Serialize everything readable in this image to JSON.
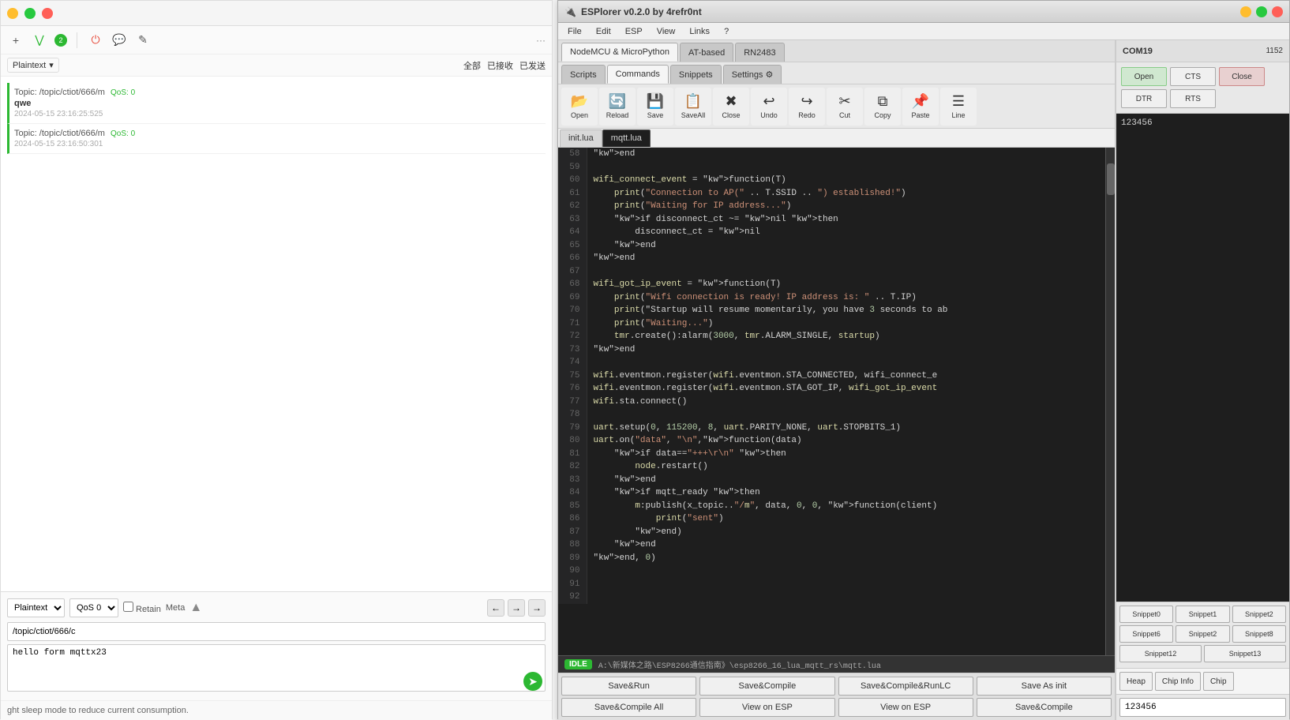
{
  "left_panel": {
    "toolbar": {
      "add_icon": "+",
      "expand_icon": "⋁",
      "badge": "2",
      "power_icon": "⏻",
      "chat_icon": "💬",
      "edit_icon": "✎",
      "dots_icon": "···",
      "format_label": "Plaintext",
      "all_label": "全部",
      "received_label": "已接收",
      "sent_label": "已发送"
    },
    "messages": [
      {
        "topic": "Topic: /topic/ctiot/666/m",
        "qos": "QoS: 0",
        "body": "qwe",
        "time": "2024-05-15 23:16:25:525"
      },
      {
        "topic": "Topic: /topic/ctiot/666/m",
        "qos": "QoS: 0",
        "body": "",
        "time": "2024-05-15 23:16:50:301"
      }
    ],
    "publish": {
      "format_label": "Plaintext",
      "qos_label": "QoS 0",
      "retain_label": "Retain",
      "meta_label": "Meta",
      "topic": "/topic/ctiot/666/c",
      "body": "hello form mqttx23"
    },
    "bottom_note": "ght sleep mode to reduce current consumption."
  },
  "esplorer": {
    "title": "ESPlorer v0.2.0 by 4refr0nt",
    "menu": {
      "file": "File",
      "edit": "Edit",
      "esp": "ESP",
      "view": "View",
      "links": "Links",
      "help": "?"
    },
    "tabs": {
      "nodemcu": "NodeMCU & MicroPython",
      "atbased": "AT-based",
      "rn2483": "RN2483"
    },
    "nav_tabs": {
      "scripts": "Scripts",
      "commands": "Commands",
      "snippets": "Snippets",
      "settings": "Settings ⚙"
    },
    "toolbar": {
      "open": "Open",
      "reload": "Reload",
      "save": "Save",
      "saveall": "SaveAll",
      "close": "Close",
      "undo": "Undo",
      "redo": "Redo",
      "cut": "Cut",
      "copy": "Copy",
      "paste": "Paste",
      "line": "Line"
    },
    "file_tabs": {
      "init": "init.lua",
      "mqtt": "mqtt.lua"
    },
    "code_lines": [
      {
        "num": 58,
        "code": "end"
      },
      {
        "num": 59,
        "code": ""
      },
      {
        "num": 60,
        "code": "wifi_connect_event = function(T)"
      },
      {
        "num": 61,
        "code": "    print(\"Connection to AP(\" .. T.SSID .. \") established!\")"
      },
      {
        "num": 62,
        "code": "    print(\"Waiting for IP address...\")"
      },
      {
        "num": 63,
        "code": "    if disconnect_ct ~= nil then"
      },
      {
        "num": 64,
        "code": "        disconnect_ct = nil"
      },
      {
        "num": 65,
        "code": "    end"
      },
      {
        "num": 66,
        "code": "end"
      },
      {
        "num": 67,
        "code": ""
      },
      {
        "num": 68,
        "code": "wifi_got_ip_event = function(T)"
      },
      {
        "num": 69,
        "code": "    print(\"Wifi connection is ready! IP address is: \" .. T.IP)"
      },
      {
        "num": 70,
        "code": "    print(\"Startup will resume momentarily, you have 3 seconds to ab"
      },
      {
        "num": 71,
        "code": "    print(\"Waiting...\")"
      },
      {
        "num": 72,
        "code": "    tmr.create():alarm(3000, tmr.ALARM_SINGLE, startup)"
      },
      {
        "num": 73,
        "code": "end"
      },
      {
        "num": 74,
        "code": ""
      },
      {
        "num": 75,
        "code": "wifi.eventmon.register(wifi.eventmon.STA_CONNECTED, wifi_connect_e"
      },
      {
        "num": 76,
        "code": "wifi.eventmon.register(wifi.eventmon.STA_GOT_IP, wifi_got_ip_event"
      },
      {
        "num": 77,
        "code": "wifi.sta.connect()"
      },
      {
        "num": 78,
        "code": ""
      },
      {
        "num": 79,
        "code": "uart.setup(0, 115200, 8, uart.PARITY_NONE, uart.STOPBITS_1)"
      },
      {
        "num": 80,
        "code": "uart.on(\"data\", \"\\n\",function(data)"
      },
      {
        "num": 81,
        "code": "    if data==\"+++\\r\\n\" then"
      },
      {
        "num": 82,
        "code": "        node.restart()"
      },
      {
        "num": 83,
        "code": "    end"
      },
      {
        "num": 84,
        "code": "    if mqtt_ready then"
      },
      {
        "num": 85,
        "code": "        m:publish(x_topic..\"/m\", data, 0, 0, function(client)"
      },
      {
        "num": 86,
        "code": "            print(\"sent\")"
      },
      {
        "num": 87,
        "code": "        end)"
      },
      {
        "num": 88,
        "code": "    end"
      },
      {
        "num": 89,
        "code": "end, 0)"
      },
      {
        "num": 90,
        "code": ""
      },
      {
        "num": 91,
        "code": ""
      },
      {
        "num": 92,
        "code": ""
      }
    ],
    "status": {
      "idle": "IDLE",
      "path": "A:\\新媒体之路\\ESP8266通信指南》\\esp8266_16_lua_mqtt_rs\\mqtt.lua"
    },
    "bottom_buttons": {
      "row1": [
        "Save&Run",
        "Save&Compile",
        "Save&Compile&RunLC",
        "Save As init"
      ],
      "row2": [
        "Save&Compile All",
        "View on ESP",
        "View on ESP",
        "Save&Compile"
      ]
    },
    "sidebar": {
      "com_label": "COM19",
      "baud": "1152",
      "open": "Open",
      "cts": "CTS",
      "close": "Close",
      "dtr": "DTR",
      "rts": "RTS",
      "serial_output": "123456",
      "snippets": [
        "Snippet0",
        "Snippet1",
        "Snippet2",
        "Snippet6",
        "Snippet2",
        "Snippet8",
        "Snippet12",
        "Snippet13"
      ],
      "utility": [
        "Heap",
        "Chip Info",
        "Chip"
      ],
      "chip_label": "Chip"
    }
  }
}
